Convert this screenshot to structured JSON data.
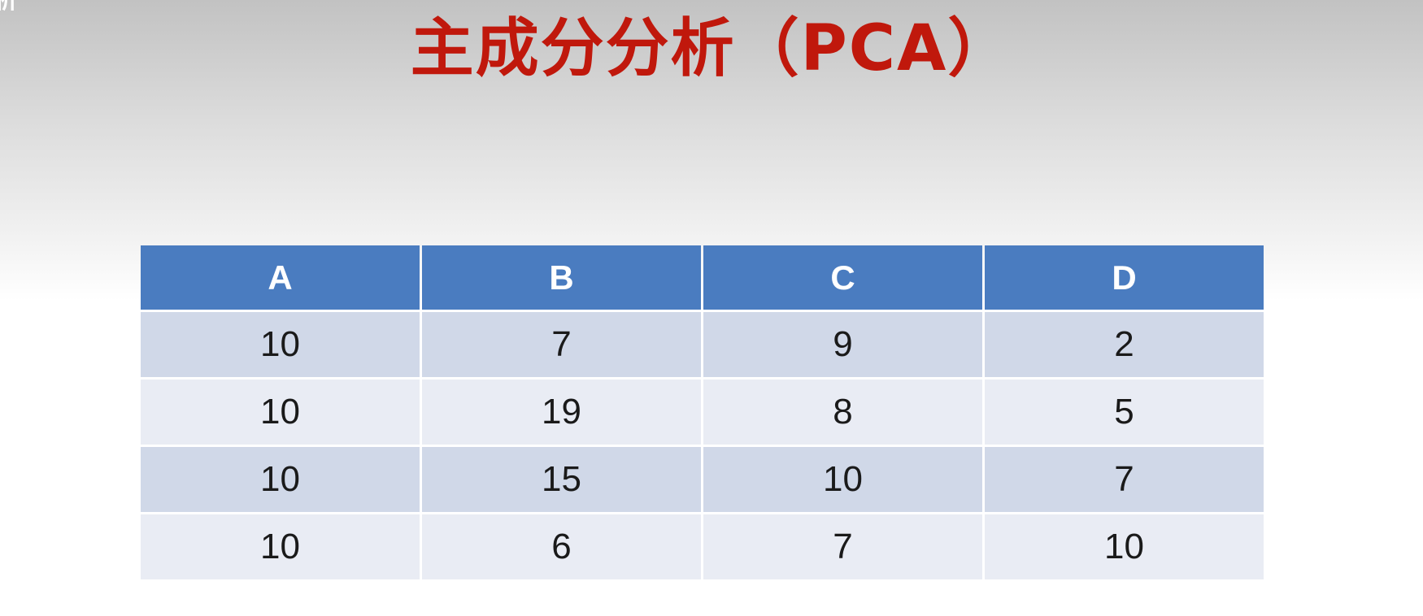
{
  "corner_text": "析",
  "title": "主成分分析（PCA）",
  "table": {
    "headers": [
      "A",
      "B",
      "C",
      "D"
    ],
    "rows": [
      [
        "10",
        "7",
        "9",
        "2"
      ],
      [
        "10",
        "19",
        "8",
        "5"
      ],
      [
        "10",
        "15",
        "10",
        "7"
      ],
      [
        "10",
        "6",
        "7",
        "10"
      ]
    ]
  },
  "colors": {
    "title": "#c0180c",
    "header_background": "#4a7cc0",
    "row_odd_background": "#d0d8e8",
    "row_even_background": "#e9ecf4"
  }
}
